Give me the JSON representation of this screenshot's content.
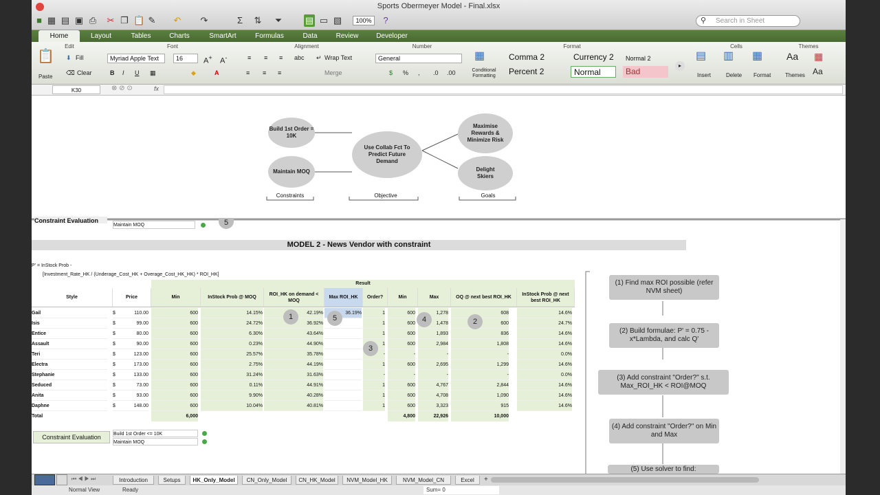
{
  "window": {
    "title": "Sports Obermeyer Model - Final.xlsx",
    "zoom": "100%",
    "search_placeholder": "Search in Sheet"
  },
  "ribbon_tabs": [
    "Home",
    "Layout",
    "Tables",
    "Charts",
    "SmartArt",
    "Formulas",
    "Data",
    "Review",
    "Developer"
  ],
  "ribbon_groups": {
    "edit": "Edit",
    "font": "Font",
    "alignment": "Alignment",
    "number": "Number",
    "format": "Format",
    "cells": "Cells",
    "themes": "Themes"
  },
  "ribbon": {
    "fill": "Fill",
    "clear": "Clear",
    "paste": "Paste",
    "font_name": "Myriad Apple Text",
    "font_size": "16",
    "wrap": "Wrap Text",
    "merge": "Merge",
    "number_format": "General",
    "cond": "Conditional Formatting",
    "styles": [
      "Comma 2",
      "Currency 2",
      "Normal 2",
      "Percent 2",
      "Normal",
      "Bad"
    ],
    "insert": "Insert",
    "delete": "Delete",
    "format": "Format",
    "themes": "Themes"
  },
  "formula_bar": {
    "cell": "K30",
    "fx": "fx"
  },
  "diagram": {
    "n1": "Build 1st Order = 10K",
    "n2": "Maintain MOQ",
    "n3": "Use Collab Fct To Predict Future Demand",
    "n4": "Maximise Rewards & Minimize Risk",
    "n5": "Delight Skiers",
    "b1": "Constraints",
    "b2": "Objective",
    "b3": "Goals"
  },
  "top_partial": {
    "label": "Constraint Evaluation",
    "row": "Maintain MOQ",
    "circle": "5"
  },
  "model_title": "MODEL 2 - News Vendor with constraint",
  "formula_text": {
    "line1": "P' = InStock Prob -",
    "line2": "[Investment_Rate_HK / (Underage_Cost_HK + Overage_Cost_HK_HK) * ROI_HK]"
  },
  "table": {
    "result_header": "Result",
    "headers": [
      "Style",
      "Price",
      "Min",
      "InStock Prob @ MOQ",
      "ROI_HK on demand < MOQ",
      "Max ROI_HK",
      "Order?",
      "Min",
      "Max",
      "OQ @ next best ROI_HK",
      "InStock Prob @ next best ROI_HK"
    ],
    "rows": [
      [
        "Gail",
        "$",
        "110.00",
        "600",
        "14.15%",
        "42.19%",
        "36.19%",
        "1",
        "600",
        "1,278",
        "608",
        "14.6%"
      ],
      [
        "Isis",
        "$",
        "99.00",
        "600",
        "24.72%",
        "36.92%",
        "",
        "1",
        "600",
        "1,478",
        "600",
        "24.7%"
      ],
      [
        "Entice",
        "$",
        "80.00",
        "600",
        "6.30%",
        "43.64%",
        "",
        "1",
        "600",
        "1,893",
        "836",
        "14.6%"
      ],
      [
        "Assault",
        "$",
        "90.00",
        "600",
        "0.23%",
        "44.90%",
        "",
        "1",
        "600",
        "2,984",
        "1,808",
        "14.6%"
      ],
      [
        "Teri",
        "$",
        "123.00",
        "600",
        "25.57%",
        "35.78%",
        "",
        "-",
        "-",
        "-",
        "-",
        "0.0%"
      ],
      [
        "Electra",
        "$",
        "173.00",
        "600",
        "2.75%",
        "44.19%",
        "",
        "1",
        "600",
        "2,695",
        "1,299",
        "14.6%"
      ],
      [
        "Stephanie",
        "$",
        "133.00",
        "600",
        "31.24%",
        "31.63%",
        "",
        "-",
        "-",
        "-",
        "-",
        "0.0%"
      ],
      [
        "Seduced",
        "$",
        "73.00",
        "600",
        "0.11%",
        "44.91%",
        "",
        "1",
        "600",
        "4,767",
        "2,844",
        "14.6%"
      ],
      [
        "Anita",
        "$",
        "93.00",
        "600",
        "9.90%",
        "40.28%",
        "",
        "1",
        "600",
        "4,708",
        "1,090",
        "14.6%"
      ],
      [
        "Daphne",
        "$",
        "148.00",
        "600",
        "10.04%",
        "40.81%",
        "",
        "1",
        "600",
        "3,323",
        "915",
        "14.6%"
      ]
    ],
    "total_label": "Total",
    "total_min": "6,000",
    "total_min2": "4,800",
    "total_max": "22,926",
    "total_oq": "10,000"
  },
  "markers": [
    "1",
    "2",
    "3",
    "4",
    "5"
  ],
  "constraint_eval": {
    "label": "Constraint Evaluation",
    "row1": "Build 1st Order <= 10K",
    "row2": "Maintain MOQ"
  },
  "flow": [
    "(1) Find max ROI possible (refer NVM sheet)",
    "(2) Build formulae: P' = 0.75 - x*Lambda, and calc Q'",
    "(3) Add constraint \"Order?\" s.t. Max_ROI_HK < ROI@MOQ",
    "(4) Add constraint \"Order?\" on Min and Max",
    "(5) Use solver to find:"
  ],
  "sheet_tabs": [
    "Introduction",
    "Setups",
    "HK_Only_Model",
    "CN_Only_Model",
    "CN_HK_Model",
    "NVM_Model_HK",
    "NVM_Model_CN",
    "Excel"
  ],
  "status": {
    "view": "Normal View",
    "ready": "Ready",
    "sum": "Sum= 0"
  },
  "colors": {
    "ribbon_green": "#4f7038",
    "cell_green": "#e6f0d8",
    "highlight_blue": "#c8d9ee"
  }
}
